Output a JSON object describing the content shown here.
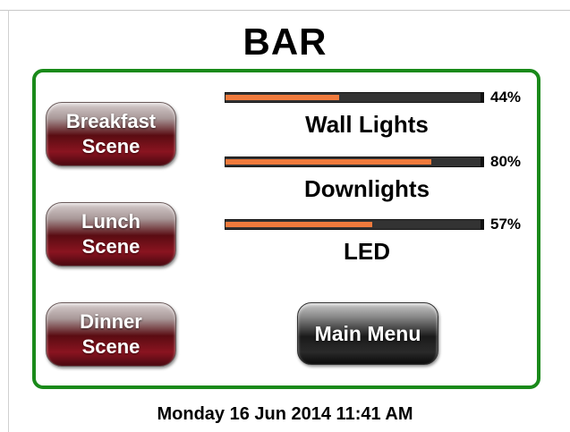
{
  "title": "BAR",
  "scenes": [
    {
      "line1": "Breakfast",
      "line2": "Scene"
    },
    {
      "line1": "Lunch",
      "line2": "Scene"
    },
    {
      "line1": "Dinner",
      "line2": "Scene"
    }
  ],
  "sliders": [
    {
      "label": "Wall Lights",
      "percent_text": "44%",
      "level": 44
    },
    {
      "label": "Downlights",
      "percent_text": "80%",
      "level": 80
    },
    {
      "label": "LED",
      "percent_text": "57%",
      "level": 57
    }
  ],
  "main_menu_label": "Main Menu",
  "datetime": "Monday 16 Jun 2014 11:41 AM",
  "colors": {
    "panel_border": "#1a8a1a",
    "slider_fill": "#f07a3c",
    "slider_track": "#333333",
    "scene_button": "#6a0e18",
    "main_menu_button": "#1a1a1a"
  }
}
